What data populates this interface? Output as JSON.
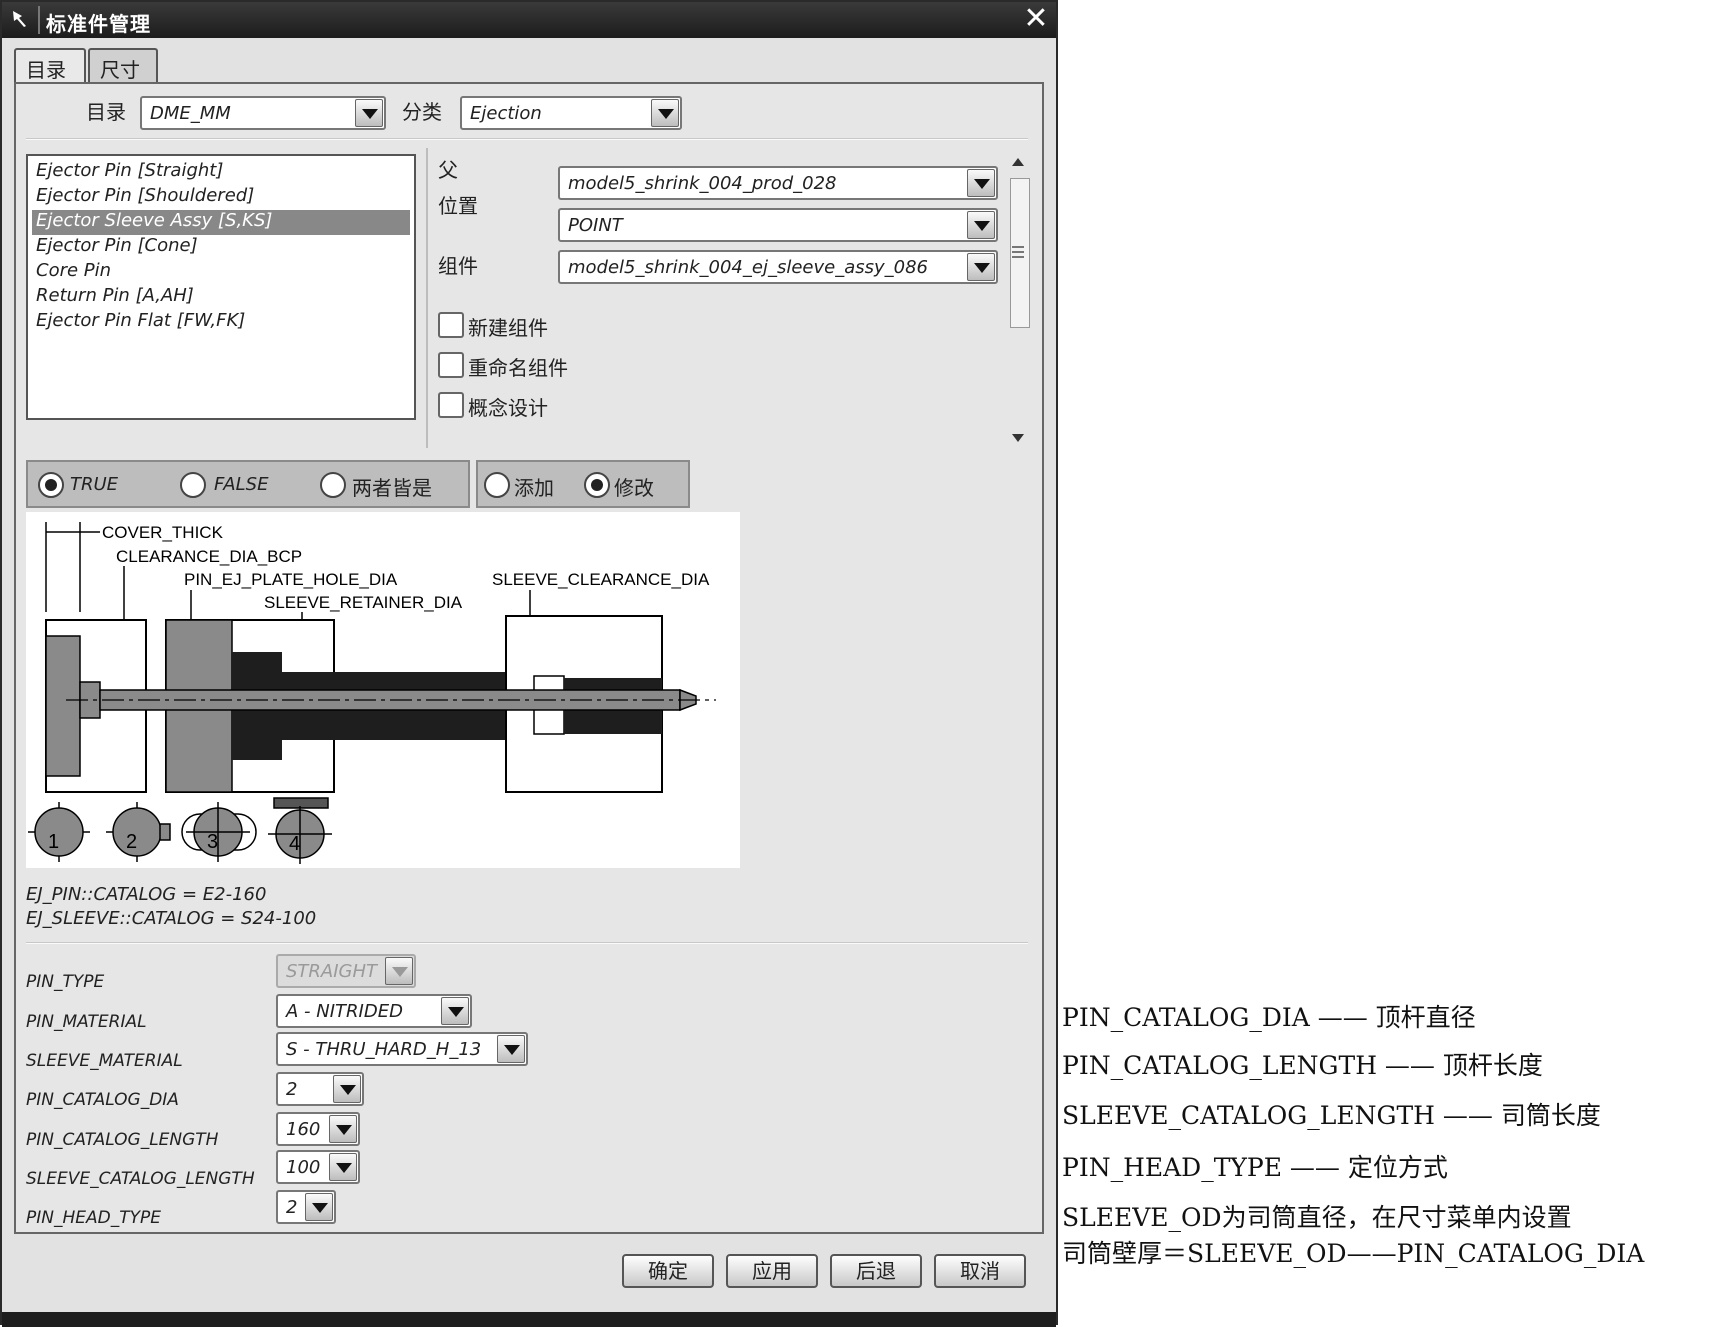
{
  "dialog": {
    "title": "标准件管理",
    "close_glyph": "✕",
    "tabs": [
      {
        "label": "目录",
        "active": true
      },
      {
        "label": "尺寸",
        "active": false
      }
    ]
  },
  "catalog": {
    "catalog_label": "目录",
    "catalog_value": "DME_MM",
    "category_label": "分类",
    "category_value": "Ejection"
  },
  "parts_list": [
    "Ejector Pin [Straight]",
    "Ejector Pin [Shouldered]",
    "Ejector Sleeve Assy [S,KS]",
    "Ejector Pin [Cone]",
    "Core Pin",
    "Return Pin [A,AH]",
    "Ejector Pin Flat [FW,FK]"
  ],
  "selected_part_index": 2,
  "fields": {
    "parent_label": "父",
    "parent_value": "model5_shrink_004_prod_028",
    "position_label": "位置",
    "position_value": "POINT",
    "component_label": "组件",
    "component_value": "model5_shrink_004_ej_sleeve_assy_086"
  },
  "checkboxes": [
    {
      "label": "新建组件",
      "checked": false
    },
    {
      "label": "重命名组件",
      "checked": false
    },
    {
      "label": "概念设计",
      "checked": false
    }
  ],
  "radio_group_1": {
    "options": [
      "TRUE",
      "FALSE",
      "两者皆是"
    ],
    "selected": "TRUE"
  },
  "radio_group_2": {
    "options": [
      "添加",
      "修改"
    ],
    "selected": "修改"
  },
  "diagram": {
    "labels": [
      "COVER_THICK",
      "CLEARANCE_DIA_BCP",
      "PIN_EJ_PLATE_HOLE_DIA",
      "SLEEVE_RETAINER_DIA",
      "SLEEVE_CLEARANCE_DIA"
    ],
    "head_types": [
      "1",
      "2",
      "3",
      "4"
    ]
  },
  "catalog_info": [
    "EJ_PIN::CATALOG = E2-160",
    "EJ_SLEEVE::CATALOG = S24-100"
  ],
  "params": [
    {
      "name": "PIN_TYPE",
      "value": "STRAIGHT",
      "disabled": true
    },
    {
      "name": "PIN_MATERIAL",
      "value": "A - NITRIDED",
      "disabled": false
    },
    {
      "name": "SLEEVE_MATERIAL",
      "value": "S - THRU_HARD_H_13",
      "disabled": false
    },
    {
      "name": "PIN_CATALOG_DIA",
      "value": "2",
      "disabled": false
    },
    {
      "name": "PIN_CATALOG_LENGTH",
      "value": "160",
      "disabled": false
    },
    {
      "name": "SLEEVE_CATALOG_LENGTH",
      "value": "100",
      "disabled": false
    },
    {
      "name": "PIN_HEAD_TYPE",
      "value": "2",
      "disabled": false
    }
  ],
  "buttons": {
    "ok": "确定",
    "apply": "应用",
    "back": "后退",
    "cancel": "取消"
  },
  "annotations": [
    "PIN_CATALOG_DIA —— 顶杆直径",
    "PIN_CATALOG_LENGTH —— 顶杆长度",
    "SLEEVE_CATALOG_LENGTH —— 司筒长度",
    "PIN_HEAD_TYPE —— 定位方式",
    "SLEEVE_OD为司筒直径，在尺寸菜单内设置",
    "司筒壁厚＝SLEEVE_OD——PIN_CATALOG_DIA"
  ]
}
